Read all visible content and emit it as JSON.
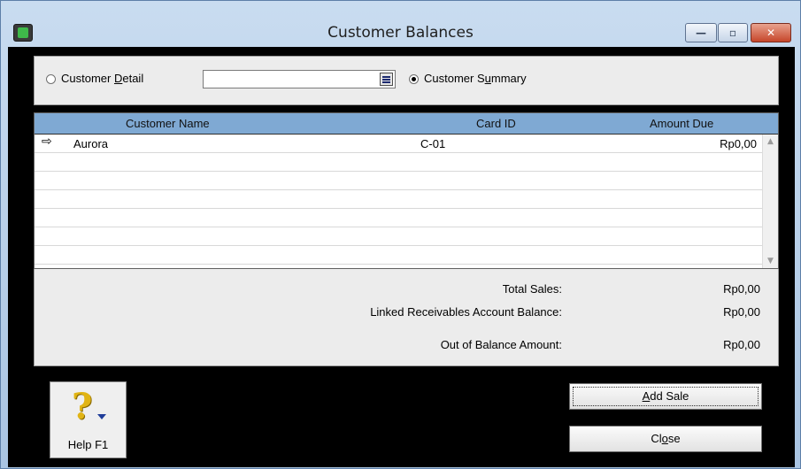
{
  "window": {
    "title": "Customer Balances",
    "minimize_glyph": "—",
    "maximize_glyph": "▫",
    "close_glyph": "✕"
  },
  "options": {
    "customer_detail": {
      "label_pre": "Customer ",
      "label_key": "D",
      "label_post": "etail",
      "selected": false
    },
    "customer_combo_value": "",
    "customer_summary": {
      "label_pre": "Customer S",
      "label_key": "u",
      "label_post": "mmary",
      "selected": true
    }
  },
  "table": {
    "columns": [
      "Customer Name",
      "Card ID",
      "Amount Due"
    ],
    "rows": [
      {
        "name": "Aurora",
        "card_id": "C-01",
        "amount": "Rp0,00",
        "arrow": "⇨"
      }
    ],
    "empty_rows": 6
  },
  "totals": {
    "total_sales_label": "Total Sales:",
    "total_sales_value": "Rp0,00",
    "linked_label": "Linked Receivables Account Balance:",
    "linked_value": "Rp0,00",
    "out_of_balance_label": "Out of Balance Amount:",
    "out_of_balance_value": "Rp0,00"
  },
  "buttons": {
    "help_label": "Help F1",
    "add_sale_pre": "",
    "add_sale_key": "A",
    "add_sale_post": "dd Sale",
    "close_pre": "Cl",
    "close_key": "o",
    "close_post": "se"
  },
  "colors": {
    "header_bg": "#7fa9d3",
    "panel_bg": "#ececec",
    "client_bg": "#000000"
  }
}
